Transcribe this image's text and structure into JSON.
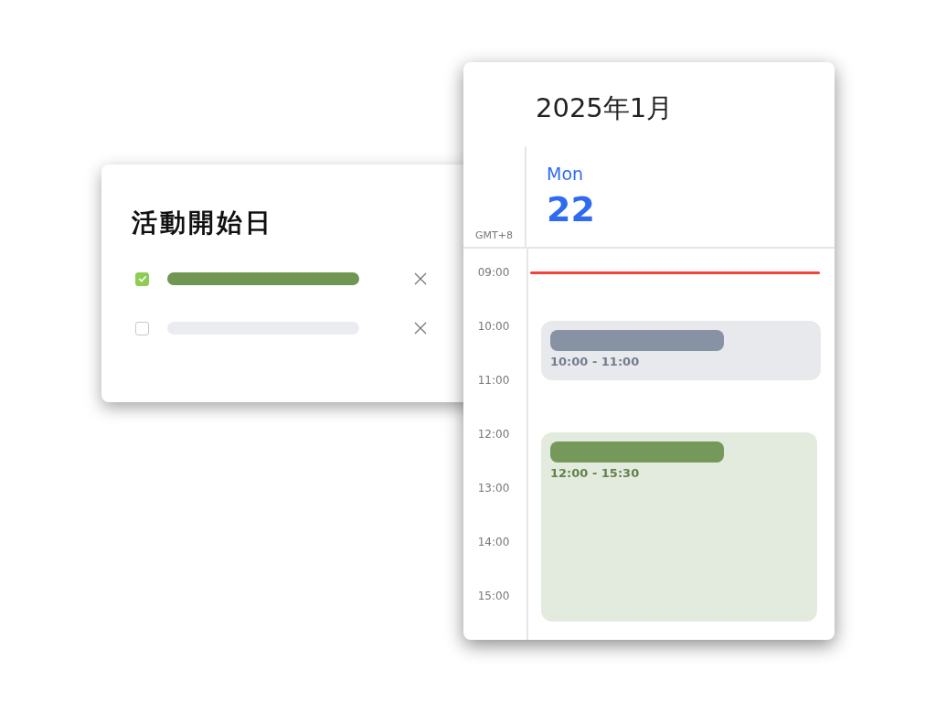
{
  "task_card": {
    "title": "活動開始日",
    "items": [
      {
        "checked": true
      },
      {
        "checked": false
      }
    ]
  },
  "calendar": {
    "title": "2025年1月",
    "timezone": "GMT+8",
    "day": {
      "weekday": "Mon",
      "date": "22"
    },
    "hours": [
      "09:00",
      "10:00",
      "11:00",
      "12:00",
      "13:00",
      "14:00",
      "15:00"
    ],
    "events": [
      {
        "time": "10:00 - 11:00",
        "color": "#8793a5"
      },
      {
        "time": "12:00 - 15:30",
        "color": "#74995a"
      }
    ]
  }
}
